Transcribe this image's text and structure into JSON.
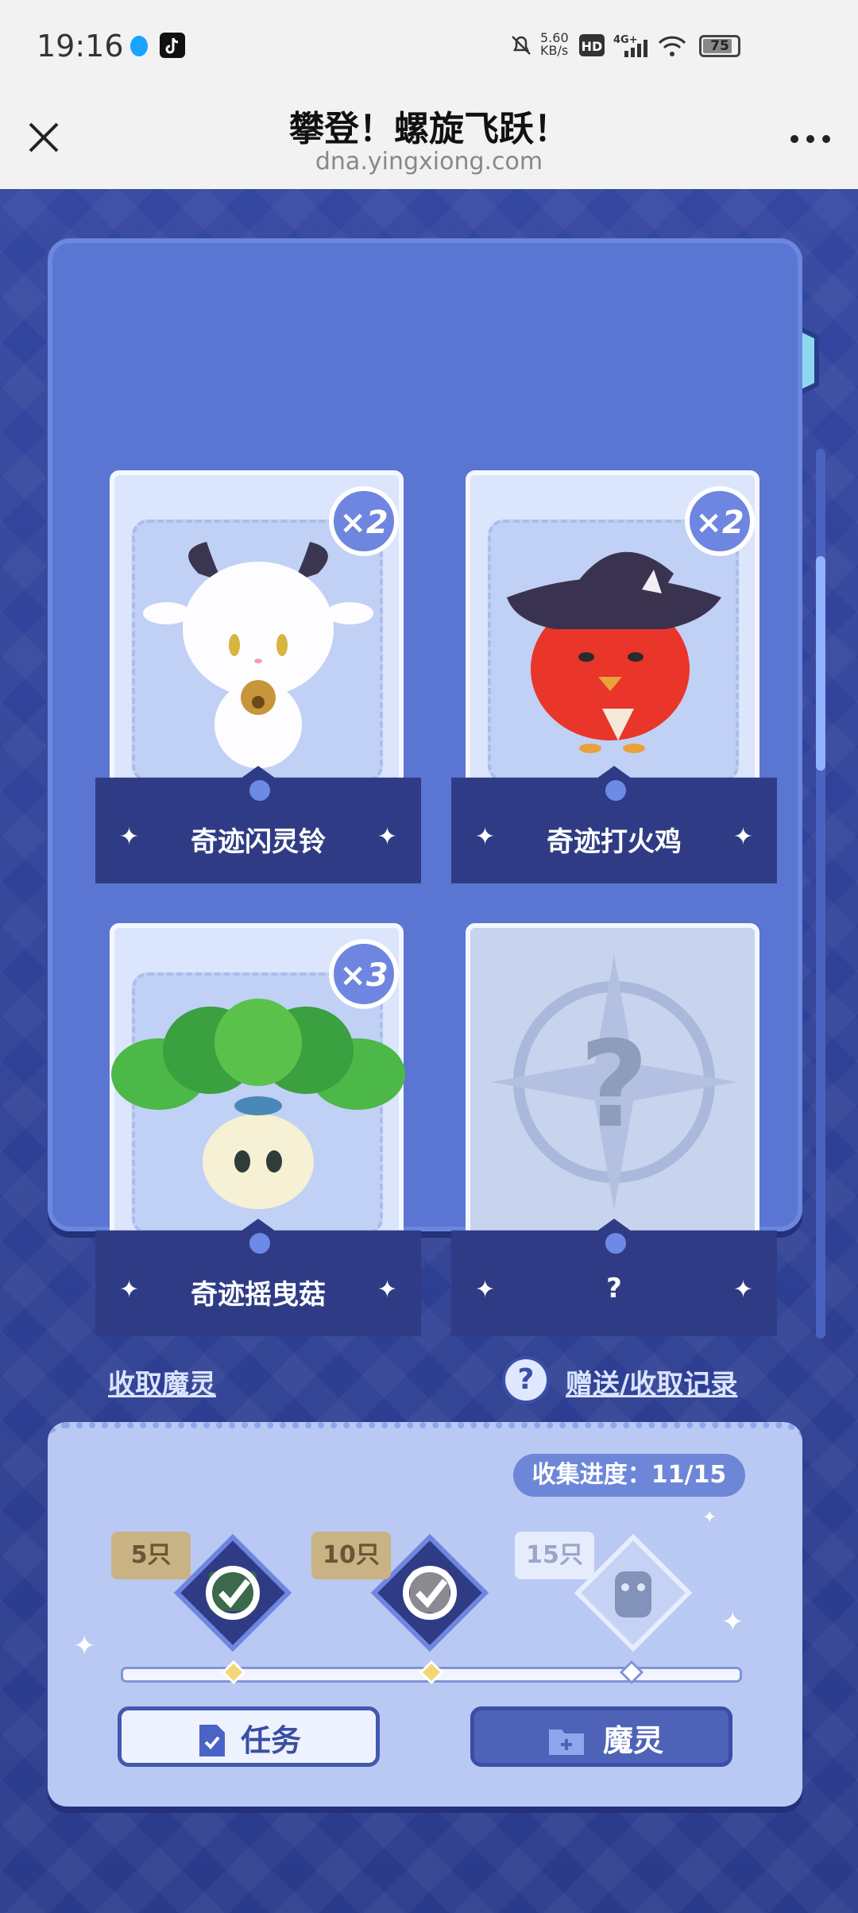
{
  "status_bar": {
    "time": "19:16",
    "net_speed": "5.60\nKB/s",
    "battery": "75"
  },
  "nav": {
    "title": "攀登！螺旋飞跃！",
    "url": "dna.yingxiong.com"
  },
  "cards": [
    {
      "name": "奇迹闪灵铃",
      "count_badge": "×2"
    },
    {
      "name": "奇迹打火鸡",
      "count_badge": "×2"
    },
    {
      "name": "奇迹摇曳菇",
      "count_badge": "×3"
    },
    {
      "name": "?",
      "count_badge": ""
    }
  ],
  "links": {
    "collect": "收取魔灵",
    "history": "赠送/收取记录"
  },
  "progress": {
    "label": "收集进度：",
    "value": "11/15",
    "collected": 11,
    "total": 15
  },
  "milestones": [
    {
      "label": "5只",
      "done": true
    },
    {
      "label": "10只",
      "done": true
    },
    {
      "label": "15只",
      "done": false
    }
  ],
  "buttons": {
    "task": "任务",
    "pet": "魔灵"
  },
  "colors": {
    "panel": "#5a76d2",
    "bg": "#2b3b8c",
    "card_label": "#2f3c85",
    "accent": "#6f86e0"
  }
}
